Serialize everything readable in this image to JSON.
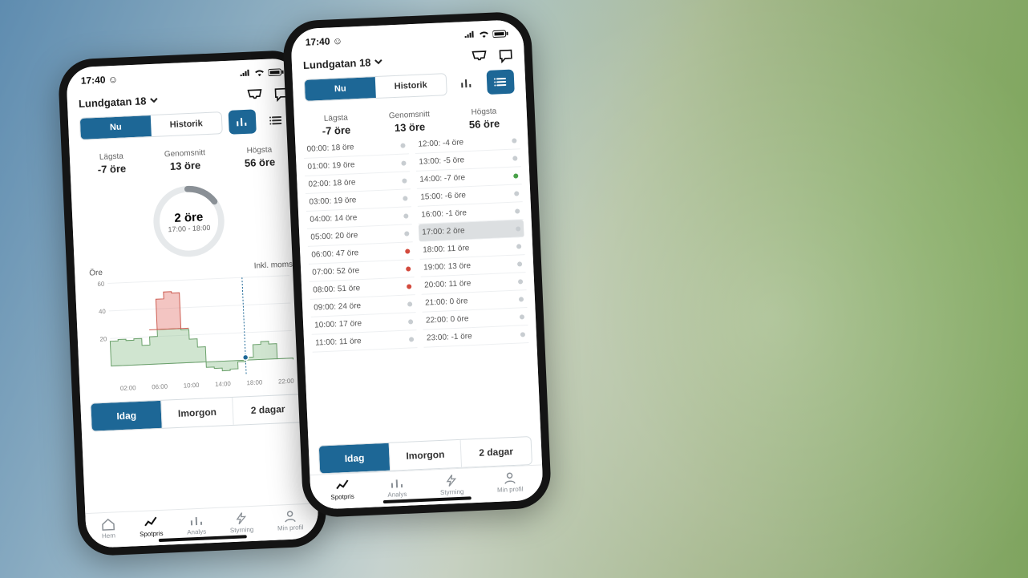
{
  "status": {
    "time": "17:40",
    "face": "☺"
  },
  "header": {
    "location": "Lundgatan 18"
  },
  "tabs": {
    "now": "Nu",
    "history": "Historik"
  },
  "stats": {
    "low_label": "Lägsta",
    "low_value": "-7 öre",
    "avg_label": "Genomsnitt",
    "avg_value": "13 öre",
    "high_label": "Högsta",
    "high_value": "56 öre"
  },
  "gauge": {
    "price": "2 öre",
    "range": "17:00 - 18:00"
  },
  "chart_axis": {
    "y_label": "Öre",
    "incl": "Inkl. moms"
  },
  "chart_data": {
    "type": "bar",
    "xlabel": "",
    "ylabel": "Öre",
    "categories": [
      "00:00",
      "01:00",
      "02:00",
      "03:00",
      "04:00",
      "05:00",
      "06:00",
      "07:00",
      "08:00",
      "09:00",
      "10:00",
      "11:00",
      "12:00",
      "13:00",
      "14:00",
      "15:00",
      "16:00",
      "17:00",
      "18:00",
      "19:00",
      "20:00",
      "21:00",
      "22:00",
      "23:00"
    ],
    "values": [
      18,
      19,
      18,
      19,
      14,
      20,
      47,
      52,
      51,
      24,
      17,
      11,
      -4,
      -5,
      -7,
      -6,
      -1,
      2,
      11,
      13,
      11,
      0,
      0,
      -1
    ],
    "ylim": [
      -10,
      60
    ],
    "x_ticks": [
      "02:00",
      "06:00",
      "10:00",
      "14:00",
      "18:00",
      "22:00"
    ],
    "y_ticks": [
      20,
      40,
      60
    ],
    "highlight_index": 17
  },
  "days": {
    "today": "Idag",
    "tomorrow": "Imorgon",
    "two": "2 dagar"
  },
  "bottom_tabs": {
    "home": "Hem",
    "spot": "Spotpris",
    "analys": "Analys",
    "styr": "Styrning",
    "profile": "Min profil"
  },
  "hour_list_left": [
    {
      "t": "00:00: 18 öre",
      "c": ""
    },
    {
      "t": "01:00: 19 öre",
      "c": ""
    },
    {
      "t": "02:00: 18 öre",
      "c": ""
    },
    {
      "t": "03:00: 19 öre",
      "c": ""
    },
    {
      "t": "04:00: 14 öre",
      "c": ""
    },
    {
      "t": "05:00: 20 öre",
      "c": ""
    },
    {
      "t": "06:00: 47 öre",
      "c": "red"
    },
    {
      "t": "07:00: 52 öre",
      "c": "red"
    },
    {
      "t": "08:00: 51 öre",
      "c": "red"
    },
    {
      "t": "09:00: 24 öre",
      "c": ""
    },
    {
      "t": "10:00: 17 öre",
      "c": ""
    },
    {
      "t": "11:00: 11 öre",
      "c": ""
    }
  ],
  "hour_list_right": [
    {
      "t": "12:00: -4 öre",
      "c": ""
    },
    {
      "t": "13:00: -5 öre",
      "c": ""
    },
    {
      "t": "14:00: -7 öre",
      "c": "green"
    },
    {
      "t": "15:00: -6 öre",
      "c": ""
    },
    {
      "t": "16:00: -1 öre",
      "c": ""
    },
    {
      "t": "17:00: 2 öre",
      "c": "",
      "sel": true
    },
    {
      "t": "18:00: 11 öre",
      "c": ""
    },
    {
      "t": "19:00: 13 öre",
      "c": ""
    },
    {
      "t": "20:00: 11 öre",
      "c": ""
    },
    {
      "t": "21:00: 0 öre",
      "c": ""
    },
    {
      "t": "22:00: 0 öre",
      "c": ""
    },
    {
      "t": "23:00: -1 öre",
      "c": ""
    }
  ]
}
